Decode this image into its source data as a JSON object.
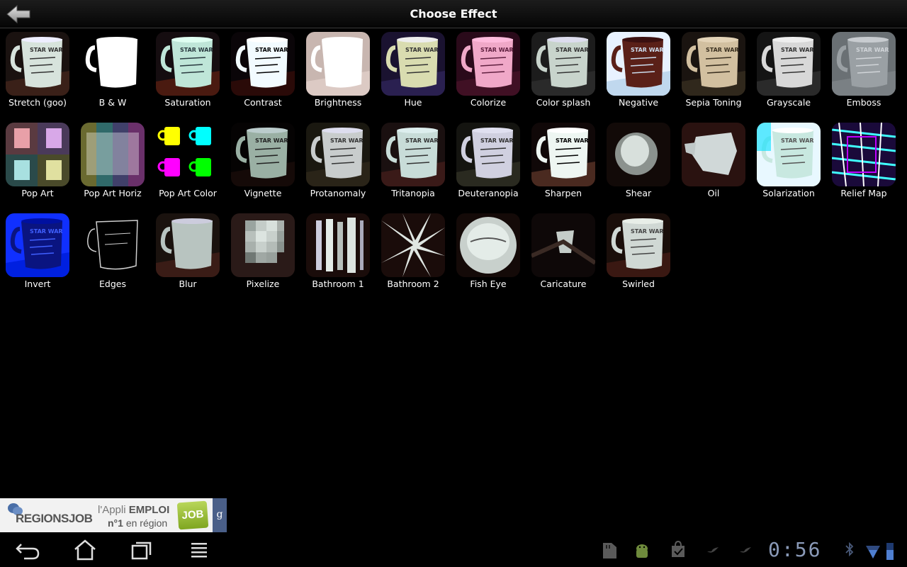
{
  "header": {
    "title": "Choose Effect"
  },
  "effects": [
    {
      "label": "Stretch (goo)",
      "style": "stretch"
    },
    {
      "label": "B & W",
      "style": "bw"
    },
    {
      "label": "Saturation",
      "style": "saturation"
    },
    {
      "label": "Contrast",
      "style": "contrast"
    },
    {
      "label": "Brightness",
      "style": "brightness"
    },
    {
      "label": "Hue",
      "style": "hue"
    },
    {
      "label": "Colorize",
      "style": "colorize"
    },
    {
      "label": "Color splash",
      "style": "colorsplash"
    },
    {
      "label": "Negative",
      "style": "negative"
    },
    {
      "label": "Sepia Toning",
      "style": "sepia"
    },
    {
      "label": "Grayscale",
      "style": "grayscale"
    },
    {
      "label": "Emboss",
      "style": "emboss"
    },
    {
      "label": "Pop Art",
      "style": "popart"
    },
    {
      "label": "Pop Art Horiz",
      "style": "popartHoriz"
    },
    {
      "label": "Pop Art Color",
      "style": "popartColor"
    },
    {
      "label": "Vignette",
      "style": "vignette"
    },
    {
      "label": "Protanomaly",
      "style": "protanomaly"
    },
    {
      "label": "Tritanopia",
      "style": "tritanopia"
    },
    {
      "label": "Deuteranopia",
      "style": "deuteranopia"
    },
    {
      "label": "Sharpen",
      "style": "sharpen"
    },
    {
      "label": "Shear",
      "style": "shear"
    },
    {
      "label": "Oil",
      "style": "oil"
    },
    {
      "label": "Solarization",
      "style": "solarization"
    },
    {
      "label": "Relief Map",
      "style": "relief"
    },
    {
      "label": "Invert",
      "style": "invert"
    },
    {
      "label": "Edges",
      "style": "edges"
    },
    {
      "label": "Blur",
      "style": "blur"
    },
    {
      "label": "Pixelize",
      "style": "pixelize"
    },
    {
      "label": "Bathroom 1",
      "style": "bathroom1"
    },
    {
      "label": "Bathroom 2",
      "style": "bathroom2"
    },
    {
      "label": "Fish Eye",
      "style": "fisheye"
    },
    {
      "label": "Caricature",
      "style": "caricature"
    },
    {
      "label": "Swirled",
      "style": "swirled"
    }
  ],
  "ad": {
    "brand": "REGIONSJOB",
    "line1_prefix": "l'Appli",
    "line1_bold": "EMPLOI",
    "line2_bold": "n°1",
    "line2_rest": "en région",
    "badge": "JOB",
    "g": "g"
  },
  "status_bar": {
    "time": "0:56"
  },
  "icons": {
    "back": "back-arrow-icon",
    "nav": [
      "back-icon",
      "home-icon",
      "recent-apps-icon",
      "menu-icon"
    ],
    "status": [
      "sd-card-icon",
      "android-debug-icon",
      "shopping-bag-icon",
      "twitter-icon",
      "twitter-icon",
      "bluetooth-icon",
      "wifi-icon",
      "battery-icon"
    ]
  }
}
